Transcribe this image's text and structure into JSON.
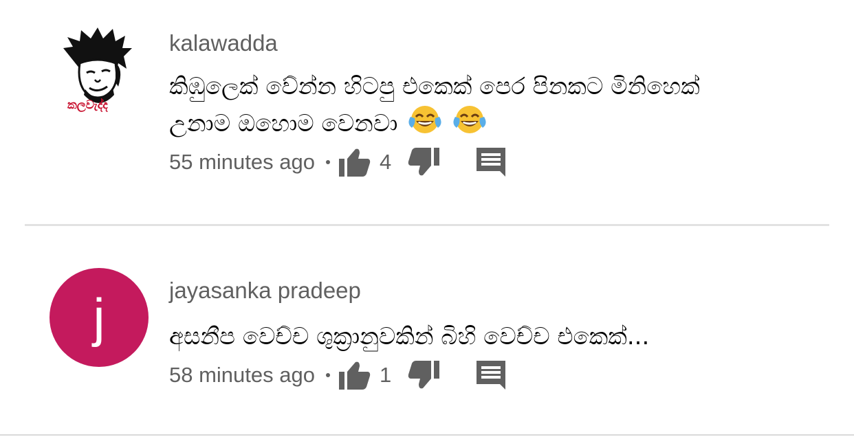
{
  "comments": [
    {
      "author": "kalawadda",
      "avatar_caption": "කලවැද්ද",
      "text_line1": "කිඹුලෙක් වේන්න හිටපු එකෙක් පෙර පිනකට  මිනිහෙක්",
      "text_line2": "උනාම ඔහොම වෙනවා",
      "emojis": [
        "face-with-tears-of-joy",
        "face-with-tears-of-joy"
      ],
      "time": "55 minutes ago",
      "likes": "4"
    },
    {
      "author": "jayasanka pradeep",
      "avatar_letter": "j",
      "avatar_color": "#c41a5d",
      "text_line1": "අසනීප වෙච්ච ශුක්‍රානුවකින් බිහි වෙච්ච එකෙක්...",
      "time": "58 minutes ago",
      "likes": "1"
    }
  ],
  "colors": {
    "secondary_text": "#606060",
    "divider": "#e2e2e2",
    "icon": "#606060"
  }
}
